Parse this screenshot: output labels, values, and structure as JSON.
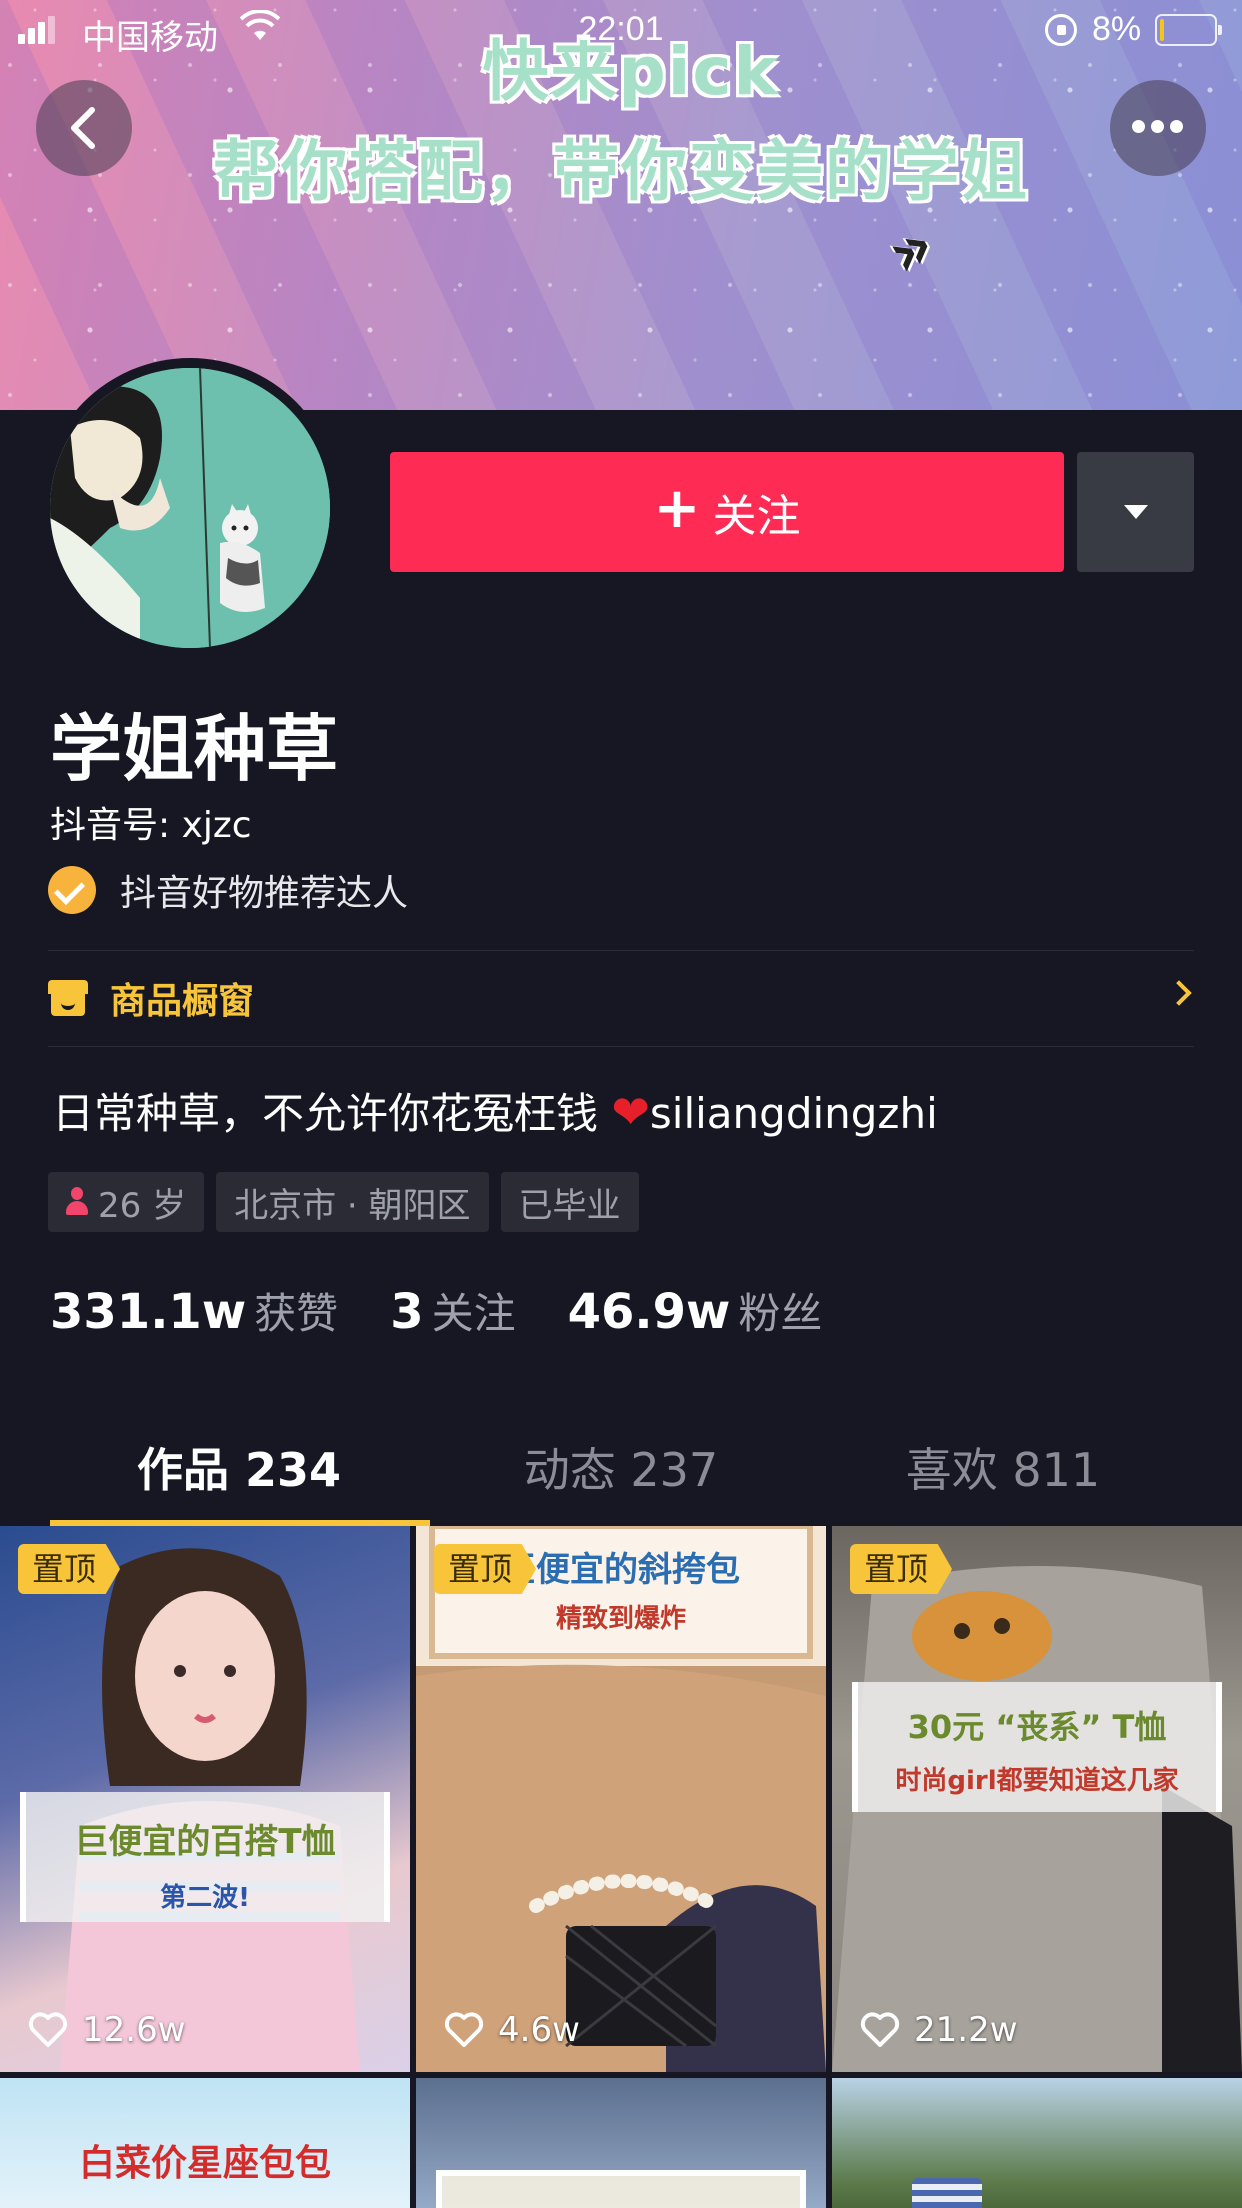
{
  "status_bar": {
    "carrier": "中国移动",
    "time": "22:01",
    "battery": "8%",
    "battery_level": 0.08
  },
  "banner": {
    "line1": "快来pick",
    "line2": "帮你搭配，带你变美的学姐"
  },
  "profile": {
    "follow_label": "关注",
    "display_name": "学姐种草",
    "handle": "抖音号: xjzc",
    "badge": "抖音好物推荐达人",
    "shop_label": "商品橱窗",
    "bio": "日常种草，不允许你花冤枉钱",
    "bio_suffix": "siliangdingzhi",
    "tags": {
      "age": "26 岁",
      "location": "北京市 · 朝阳区",
      "status": "已毕业"
    },
    "stats": {
      "likes_count": "331.1w",
      "likes_label": "获赞",
      "following_count": "3",
      "following_label": "关注",
      "followers_count": "46.9w",
      "followers_label": "粉丝"
    }
  },
  "tabs": [
    {
      "label": "作品 234"
    },
    {
      "label": "动态 237"
    },
    {
      "label": "喜欢 811"
    }
  ],
  "videos": [
    {
      "pinned": "置顶",
      "likes": "12.6w",
      "caption": "巨便宜的百搭T恤",
      "subcaption": "第二波!"
    },
    {
      "pinned": "置顶",
      "likes": "4.6w",
      "caption": "巨便宜的斜挎包",
      "subcaption": "精致到爆炸"
    },
    {
      "pinned": "置顶",
      "likes": "21.2w",
      "caption": "30元 “丧系” T恤",
      "subcaption": "时尚girl都要知道这几家"
    },
    {
      "caption": "白菜价星座包包"
    },
    {
      "caption": ""
    },
    {
      "caption": ""
    }
  ],
  "colors": {
    "background": "#161722",
    "follow_button": "#fe2c55",
    "accent_yellow": "#f8c43a",
    "muted_text": "#9ea0aa"
  }
}
